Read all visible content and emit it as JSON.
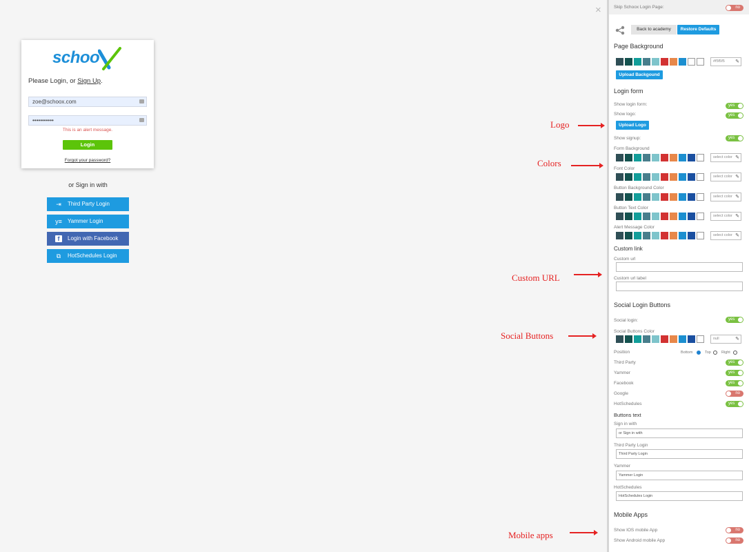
{
  "canvas": {
    "close_glyph": "×"
  },
  "login_card": {
    "brand_text": "schoo",
    "brand_mark": "X",
    "prompt_prefix": "Please Login, or ",
    "signup_link": "Sign Up",
    "prompt_suffix": ".",
    "email_value": "zoe@schoox.com",
    "password_value": "•••••••••••",
    "alert_message": "This is an alert message.",
    "login_button": "Login",
    "forgot_link": "Forgot your password?"
  },
  "social_area": {
    "or_sign_in": "or Sign in with",
    "buttons": [
      {
        "label": "Third Party Login",
        "icon": "sign-in-icon",
        "glyph": "⇥"
      },
      {
        "label": "Yammer Login",
        "icon": "yammer-icon",
        "glyph": "y≡"
      },
      {
        "label": "Login with Facebook",
        "icon": "facebook-icon",
        "glyph": "f"
      },
      {
        "label": "HotSchedules Login",
        "icon": "hotschedules-icon",
        "glyph": "⧉"
      }
    ]
  },
  "annotations": {
    "logo": "Logo",
    "colors": "Colors",
    "custom_url": "Custom URL",
    "social_buttons": "Social Buttons",
    "mobile_apps": "Mobile apps"
  },
  "panel": {
    "skip_label": "Skip Schoox Login Page:",
    "skip_toggle": "no",
    "share_icon": "share-icon",
    "back_button": "Back to academy",
    "restore_button": "Restore Defaults",
    "page_background": {
      "title": "Page Background",
      "value": "#f5f5f5",
      "upload_button": "Upload Backgound"
    },
    "login_form": {
      "title": "Login form",
      "show_login_form": "Show login form:",
      "show_login_form_toggle": "yes",
      "show_logo": "Show logo:",
      "show_logo_toggle": "yes",
      "upload_logo": "Upload Logo",
      "show_signup": "Show signup:",
      "show_signup_toggle": "yes",
      "color_rows": [
        {
          "label": "Form Background",
          "value": "select color"
        },
        {
          "label": "Font Color",
          "value": "select color"
        },
        {
          "label": "Button Background Color",
          "value": "select color"
        },
        {
          "label": "Button Text Color",
          "value": "select color"
        },
        {
          "label": "Alert Message Color",
          "value": "select color"
        }
      ]
    },
    "custom_link": {
      "title": "Custom link",
      "url_label": "Custom url",
      "url_value": "",
      "label_label": "Custom url label",
      "label_value": ""
    },
    "social": {
      "title": "Social Login Buttons",
      "social_login": "Social login:",
      "social_login_toggle": "yes",
      "buttons_color": "Social Buttons Color",
      "buttons_color_value": "null",
      "position_label": "Position",
      "position_options": [
        "Bottom",
        "Top",
        "Right"
      ],
      "position_selected": "Bottom",
      "providers": [
        {
          "label": "Third Party",
          "toggle": "yes"
        },
        {
          "label": "Yammer",
          "toggle": "yes"
        },
        {
          "label": "Facebook",
          "toggle": "yes"
        },
        {
          "label": "Google",
          "toggle": "no"
        },
        {
          "label": "HotSchedules",
          "toggle": "yes"
        }
      ],
      "buttons_text_title": "Buttons text",
      "text_fields": [
        {
          "label": "Sign in with",
          "value": "or Sign in with"
        },
        {
          "label": "Third Party Login",
          "value": "Third Party Login"
        },
        {
          "label": "Yammer",
          "value": "Yammer Login"
        },
        {
          "label": "HotSchedules",
          "value": "HotSchedules Login"
        }
      ]
    },
    "mobile": {
      "title": "Mobile Apps",
      "ios_label": "Show IOS mobile App",
      "ios_toggle": "no",
      "android_label": "Show Android mobile App",
      "android_toggle": "no"
    },
    "palette": [
      "#2f4f56",
      "#14524f",
      "#129e9a",
      "#487e8c",
      "#7ec4cb",
      "#d23232",
      "#e8884a",
      "#1c8fd0",
      "#1a4fa0",
      "#ffffff"
    ],
    "page_palette": [
      "#2f4f56",
      "#14524f",
      "#129e9a",
      "#487e8c",
      "#7ec4cb",
      "#d23232",
      "#e8884a",
      "#1c8fd0",
      "#ffffff",
      "#ffffff"
    ],
    "colors": {
      "accent": "#1e9be0",
      "yes": "#7ac142",
      "no": "#d9776f",
      "login_green": "#5cc40a",
      "facebook": "#4267b2",
      "annotation": "#e52222"
    }
  }
}
